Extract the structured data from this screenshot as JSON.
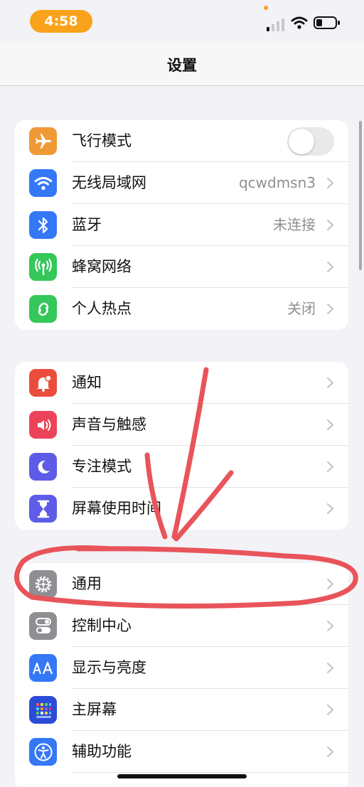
{
  "status_bar": {
    "time": "4:58"
  },
  "nav": {
    "title": "设置"
  },
  "groups": [
    {
      "rows": [
        {
          "label": "飞行模式",
          "icon": "airplane-icon",
          "color": "#f09a37",
          "toggle": false
        },
        {
          "label": "无线局域网",
          "icon": "wifi-icon",
          "color": "#3478f6",
          "value": "qcwdmsn3"
        },
        {
          "label": "蓝牙",
          "icon": "bluetooth-icon",
          "color": "#3478f6",
          "value": "未连接"
        },
        {
          "label": "蜂窝网络",
          "icon": "cellular-icon",
          "color": "#34c759",
          "value": ""
        },
        {
          "label": "个人热点",
          "icon": "hotspot-icon",
          "color": "#34c759",
          "value": "关闭"
        }
      ]
    },
    {
      "rows": [
        {
          "label": "通知",
          "icon": "notification-icon",
          "color": "#eb4d3d"
        },
        {
          "label": "声音与触感",
          "icon": "speaker-icon",
          "color": "#eb445a"
        },
        {
          "label": "专注模式",
          "icon": "moon-icon",
          "color": "#5e5ce6"
        },
        {
          "label": "屏幕使用时间",
          "icon": "hourglass-icon",
          "color": "#5e5ce6"
        }
      ]
    },
    {
      "rows": [
        {
          "label": "通用",
          "icon": "gear-icon",
          "color": "#8e8e93"
        },
        {
          "label": "控制中心",
          "icon": "switches-icon",
          "color": "#8e8e93"
        },
        {
          "label": "显示与亮度",
          "icon": "text-size-icon",
          "color": "#3478f6"
        },
        {
          "label": "主屏幕",
          "icon": "home-screen-icon",
          "color": "#3478f6"
        },
        {
          "label": "辅助功能",
          "icon": "accessibility-icon",
          "color": "#3478f6"
        }
      ]
    }
  ]
}
